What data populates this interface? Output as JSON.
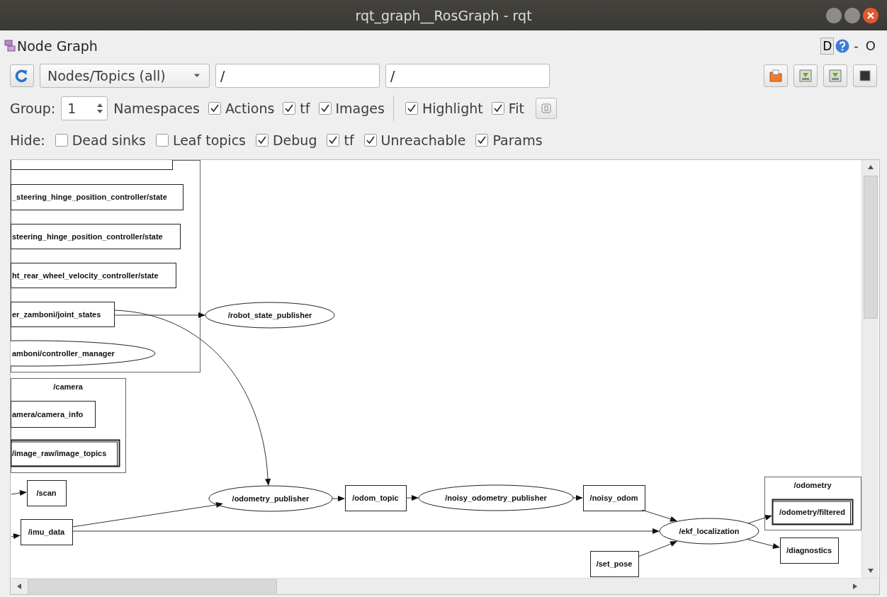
{
  "window": {
    "title": "rqt_graph__RosGraph - rqt"
  },
  "panel": {
    "title": "Node Graph",
    "dock_label": "D",
    "dock_buttons": [
      "-",
      "O"
    ]
  },
  "toolbar": {
    "filter_mode": "Nodes/Topics (all)",
    "node_filter": "/",
    "topic_filter": "/"
  },
  "options": {
    "group_label": "Group:",
    "group_value": "1",
    "namespaces_label": "Namespaces",
    "checkboxes": [
      {
        "label": "Actions",
        "checked": true
      },
      {
        "label": "tf",
        "checked": true
      },
      {
        "label": "Images",
        "checked": true
      }
    ],
    "view_checkboxes": [
      {
        "label": "Highlight",
        "checked": true
      },
      {
        "label": "Fit",
        "checked": true
      }
    ]
  },
  "hide": {
    "label": "Hide:",
    "checkboxes": [
      {
        "label": "Dead sinks",
        "checked": false
      },
      {
        "label": "Leaf topics",
        "checked": false
      },
      {
        "label": "Debug",
        "checked": true
      },
      {
        "label": "tf",
        "checked": true
      },
      {
        "label": "Unreachable",
        "checked": true
      },
      {
        "label": "Params",
        "checked": true
      }
    ]
  },
  "graph": {
    "nodes": [
      {
        "kind": "namespace"
      },
      {
        "kind": "topic"
      },
      {
        "kind": "topic",
        "label": "_steering_hinge_position_controller/state"
      },
      {
        "kind": "topic",
        "label": "steering_hinge_position_controller/state"
      },
      {
        "kind": "topic",
        "label": "ht_rear_wheel_velocity_controller/state"
      },
      {
        "kind": "topic",
        "label": "er_zamboni/joint_states"
      },
      {
        "kind": "node",
        "label": "/robot_state_publisher"
      },
      {
        "kind": "node",
        "label": "amboni/controller_manager"
      },
      {
        "kind": "namespace",
        "label": "/camera"
      },
      {
        "kind": "topic",
        "label": "amera/camera_info"
      },
      {
        "kind": "topic_group",
        "label": "/image_raw/image_topics"
      },
      {
        "kind": "topic",
        "label": "/scan"
      },
      {
        "kind": "node",
        "label": "/odometry_publisher"
      },
      {
        "kind": "topic",
        "label": "/odom_topic"
      },
      {
        "kind": "node",
        "label": "/noisy_odometry_publisher"
      },
      {
        "kind": "topic",
        "label": "/noisy_odom"
      },
      {
        "kind": "namespace",
        "label": "/odometry"
      },
      {
        "kind": "topic_group",
        "label": "/odometry/filtered"
      },
      {
        "kind": "topic",
        "label": "/imu_data"
      },
      {
        "kind": "node",
        "label": "/ekf_localization"
      },
      {
        "kind": "topic",
        "label": "/diagnostics"
      },
      {
        "kind": "topic",
        "label": "/set_pose"
      }
    ]
  }
}
